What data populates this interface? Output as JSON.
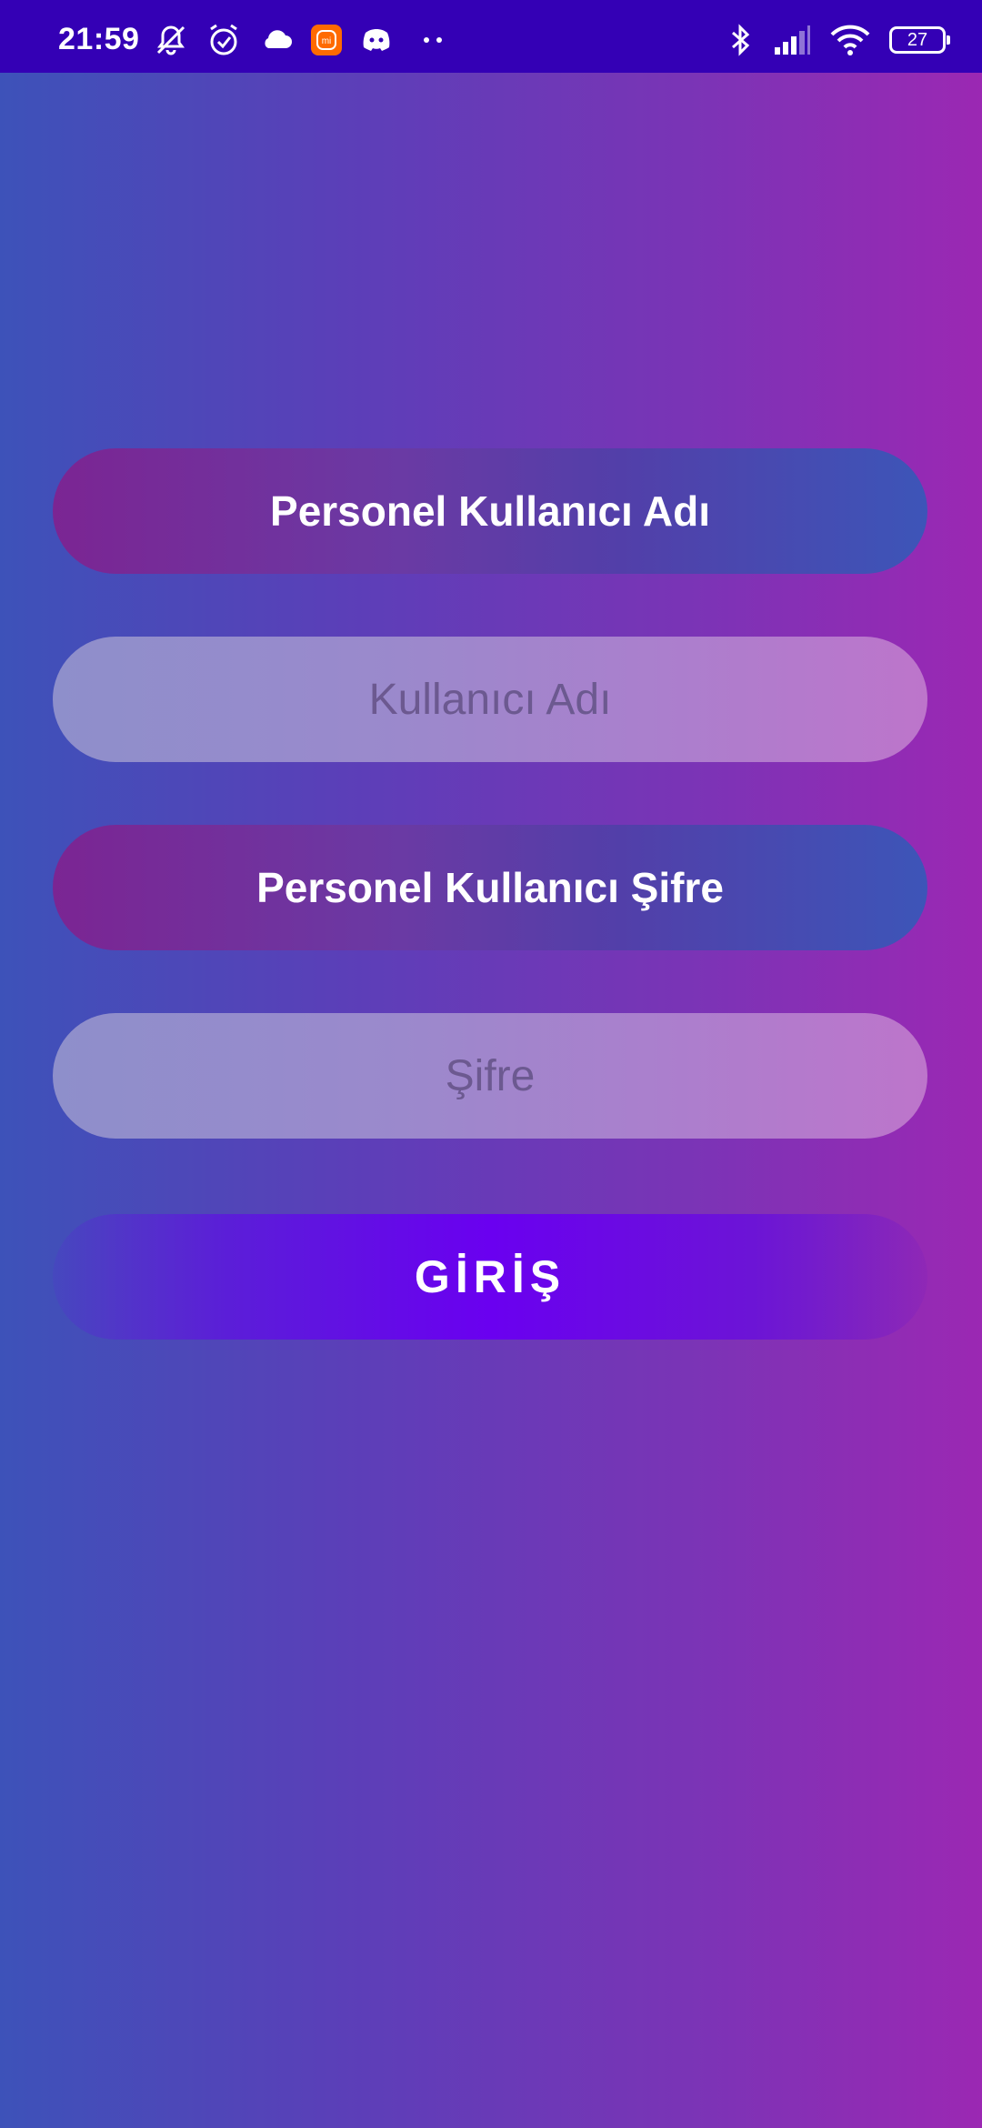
{
  "status_bar": {
    "time": "21:59",
    "battery": "27",
    "mi_badge_text": "mi",
    "icons_left": [
      "muted-bell-icon",
      "alarm-icon",
      "cloud-icon",
      "mi-app-icon",
      "discord-icon",
      "more-dots-icon"
    ],
    "icons_right": [
      "bluetooth-icon",
      "signal-icon",
      "wifi-icon",
      "battery-icon"
    ],
    "background": "#3400b5"
  },
  "form": {
    "username_label": "Personel Kullanıcı Adı",
    "username_placeholder": "Kullanıcı Adı",
    "password_label": "Personel Kullanıcı Şifre",
    "password_placeholder": "Şifre",
    "login_button": "GİRİŞ"
  },
  "colors": {
    "background_start": "#3d52b9",
    "background_end": "#9b28b3",
    "button_accent": "#6a00f0"
  }
}
